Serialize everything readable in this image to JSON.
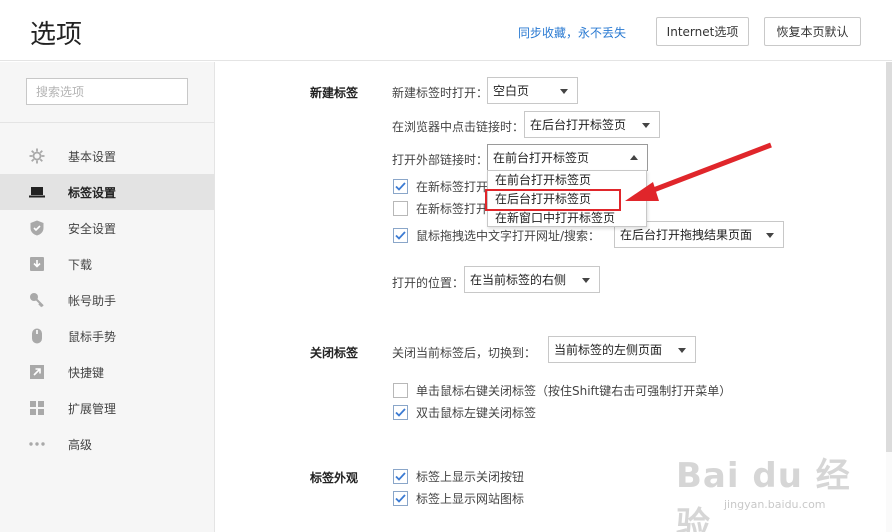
{
  "header": {
    "title": "选项",
    "sync_link": "同步收藏，永不丢失",
    "internet_btn": "Internet选项",
    "restore_btn": "恢复本页默认"
  },
  "sidebar": {
    "search_placeholder": "搜索选项",
    "items": [
      {
        "label": "基本设置",
        "icon": "gear-icon"
      },
      {
        "label": "标签设置",
        "icon": "laptop-icon",
        "active": true
      },
      {
        "label": "安全设置",
        "icon": "shield-icon"
      },
      {
        "label": "下载",
        "icon": "download-icon"
      },
      {
        "label": "帐号助手",
        "icon": "key-icon"
      },
      {
        "label": "鼠标手势",
        "icon": "mouse-icon"
      },
      {
        "label": "快捷键",
        "icon": "shortcut-icon"
      },
      {
        "label": "扩展管理",
        "icon": "grid-icon"
      },
      {
        "label": "高级",
        "icon": "more-icon"
      }
    ]
  },
  "new_tab": {
    "section": "新建标签",
    "open_label": "新建标签时打开：",
    "open_value": "空白页",
    "link_click_label": "在浏览器中点击链接时：",
    "link_click_value": "在后台打开标签页",
    "external_label": "打开外部链接时：",
    "external_value": "在前台打开标签页",
    "cb1_label": "在新标签打开",
    "cb2_label": "在新标签打开",
    "drag_label": "鼠标拖拽选中文字打开网址/搜索：",
    "drag_value": "在后台打开拖拽结果页面",
    "position_label": "打开的位置：",
    "position_value": "在当前标签的右侧",
    "dropdown_options": [
      "在前台打开标签页",
      "在后台打开标签页",
      "在新窗口中打开标签页"
    ]
  },
  "close_tab": {
    "section": "关闭标签",
    "switch_label": "关闭当前标签后，切换到：",
    "switch_value": "当前标签的左侧页面",
    "right_click_label": "单击鼠标右键关闭标签（按住Shift键右击可强制打开菜单）",
    "dbl_click_label": "双击鼠标左键关闭标签"
  },
  "appearance": {
    "section": "标签外观",
    "close_btn_label": "标签上显示关闭按钮",
    "site_icon_label": "标签上显示网站图标"
  },
  "watermark": {
    "main": "Bai du 经验",
    "sub": "jingyan.baidu.com"
  },
  "colors": {
    "accent": "#2a7ad2",
    "highlight": "#e0262b",
    "check": "#3b7bd4"
  }
}
